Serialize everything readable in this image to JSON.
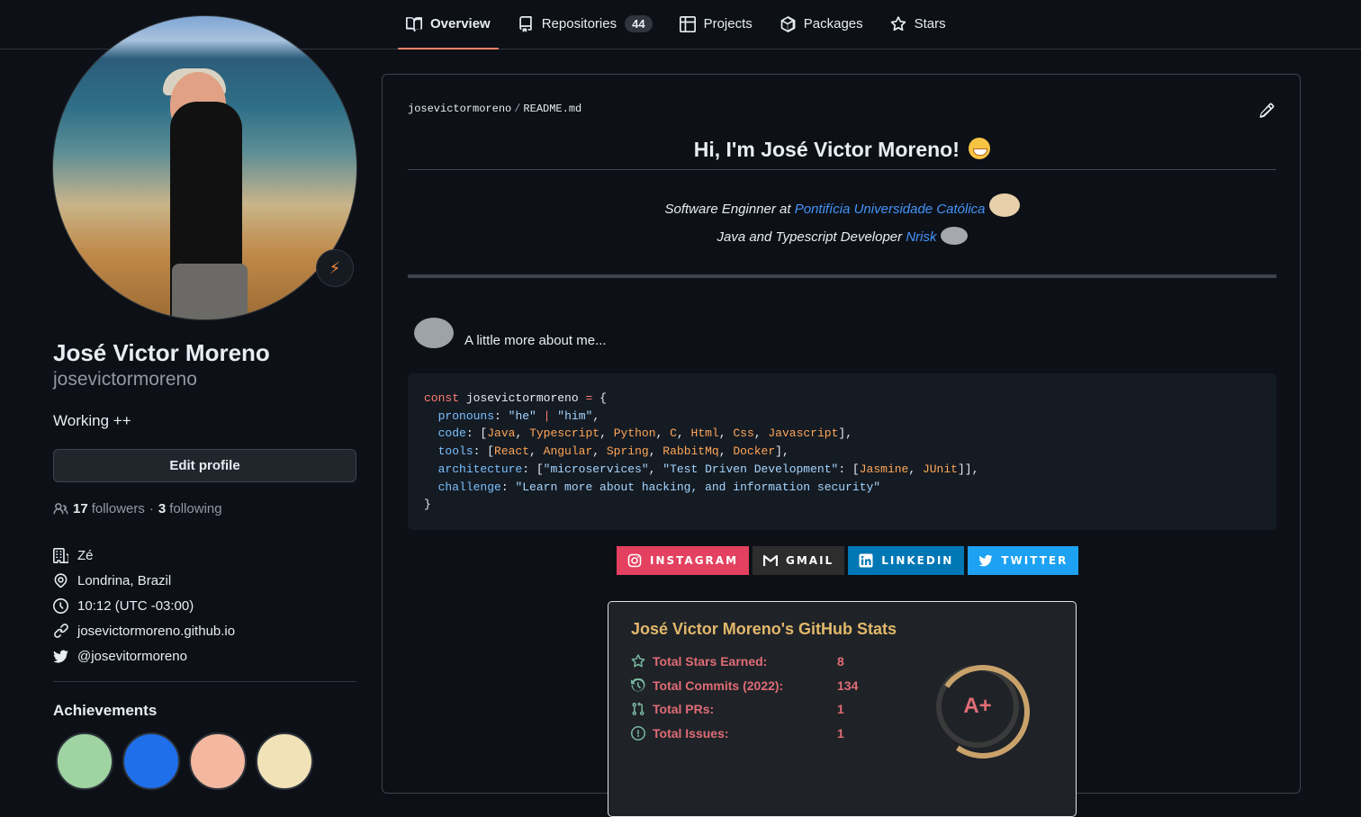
{
  "nav": {
    "tabs": [
      {
        "label": "Overview"
      },
      {
        "label": "Repositories",
        "count": "44"
      },
      {
        "label": "Projects"
      },
      {
        "label": "Packages"
      },
      {
        "label": "Stars"
      }
    ]
  },
  "profile": {
    "full_name": "José Victor Moreno",
    "login": "josevictormoreno",
    "bio": "Working ++",
    "edit_label": "Edit profile",
    "followers_count": "17",
    "followers_label": "followers",
    "following_count": "3",
    "following_label": "following",
    "company": "Zé",
    "location": "Londrina, Brazil",
    "time": "10:12 (UTC -03:00)",
    "website": "josevictormoreno.github.io",
    "twitter": "@josevitormoreno",
    "achievements_title": "Achievements"
  },
  "readme": {
    "owner": "josevictormoreno",
    "file": "README.md",
    "title": "Hi, I'm José Victor Moreno!",
    "line1_prefix": "Software Enginner at",
    "line1_link": "Pontifícia Universidade Católica",
    "line2_prefix": "Java and Typescript Developer",
    "line2_link": "Nrisk",
    "more_about": "A little more about me...",
    "code": {
      "const": "const",
      "name": "josevictormoreno",
      "pronouns_key": "pronouns",
      "pronouns_1": "\"he\"",
      "pronouns_2": "\"him\"",
      "code_key": "code",
      "code_items": [
        "Java",
        "Typescript",
        "Python",
        "C",
        "Html",
        "Css",
        "Javascript"
      ],
      "tools_key": "tools",
      "tools_items": [
        "React",
        "Angular",
        "Spring",
        "RabbitMq",
        "Docker"
      ],
      "arch_key": "architecture",
      "arch_1": "\"microservices\"",
      "arch_2": "\"Test Driven Development\"",
      "arch_items": [
        "Jasmine",
        "JUnit"
      ],
      "challenge_key": "challenge",
      "challenge_val": "\"Learn more about hacking, and information security\""
    },
    "socials": [
      {
        "label": "INSTAGRAM",
        "color": "#e4405f"
      },
      {
        "label": "GMAIL",
        "color": "#2d2d2d"
      },
      {
        "label": "LINKEDIN",
        "color": "#0077b5"
      },
      {
        "label": "TWITTER",
        "color": "#1da1f2"
      }
    ],
    "stats": {
      "title": "José Victor Moreno's GitHub Stats",
      "rows": [
        {
          "label": "Total Stars Earned:",
          "value": "8"
        },
        {
          "label": "Total Commits (2022):",
          "value": "134"
        },
        {
          "label": "Total PRs:",
          "value": "1"
        },
        {
          "label": "Total Issues:",
          "value": "1"
        }
      ],
      "grade": "A+"
    }
  },
  "colors": {
    "accent": "#f78166",
    "link": "#4493f8",
    "stat_title": "#e2b86b",
    "stat_text": "#e06c75"
  }
}
